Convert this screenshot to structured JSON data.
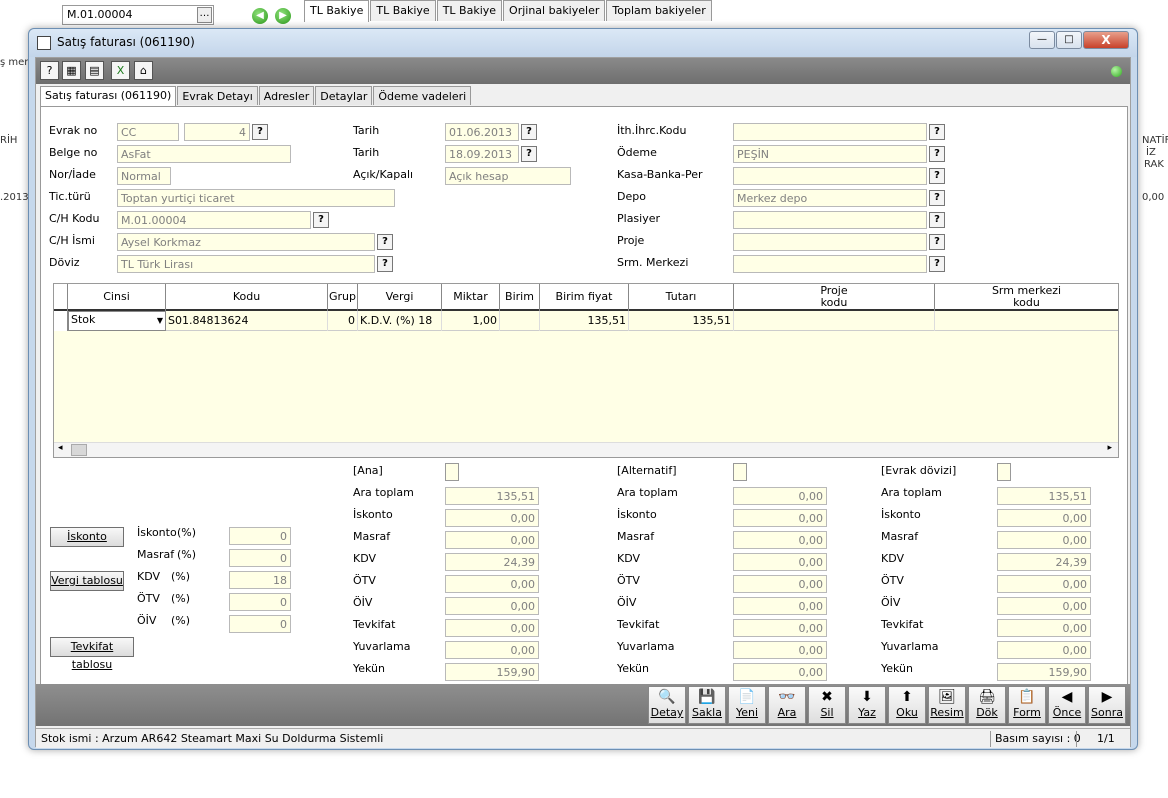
{
  "background": {
    "account_combo": "M.01.00004",
    "tabs": [
      "TL Bakiye",
      "TL Bakiye",
      "TL Bakiye",
      "Orjinal bakiyeler",
      "Toplam bakiyeler"
    ],
    "left_fragments": [
      "ş merk",
      "RİH",
      ".2013"
    ],
    "right_fragments": [
      "NATİF",
      "İZ",
      "RAK",
      "0,00"
    ]
  },
  "window": {
    "title": "Satış faturası (061190)",
    "min_label": "—",
    "max_label": "□",
    "close_label": "X",
    "toolbar_icons": [
      "help-icon",
      "calculator-icon",
      "print-preview-icon",
      "excel-icon",
      "home-icon"
    ],
    "toolbar_glyphs": [
      "?",
      "▦",
      "▤",
      "X",
      "⌂"
    ]
  },
  "form_tabs": [
    "Satış faturası (061190)",
    "Evrak Detayı",
    "Adresler",
    "Detaylar",
    "Ödeme vadeleri"
  ],
  "fields": {
    "evrak_no": {
      "label": "Evrak no",
      "seri": "CC",
      "sira": "4"
    },
    "belge_no": {
      "label": "Belge no",
      "value": "AsFat"
    },
    "nor_iade": {
      "label": "Nor/İade",
      "value": "Normal"
    },
    "tic_turu": {
      "label": "Tic.türü",
      "value": "Toptan yurtiçi ticaret"
    },
    "ch_kodu": {
      "label": "C/H Kodu",
      "value": "M.01.00004"
    },
    "ch_ismi": {
      "label": "C/H İsmi",
      "value": "Aysel Korkmaz"
    },
    "doviz": {
      "label": "Döviz",
      "value": "TL  Türk Lirası"
    },
    "tarih1": {
      "label": "Tarih",
      "value": "01.06.2013"
    },
    "tarih2": {
      "label": "Tarih",
      "value": "18.09.2013"
    },
    "acik_kapali": {
      "label": "Açık/Kapalı",
      "value": "Açık hesap"
    },
    "ith_ihrc": {
      "label": "İth.İhrc.Kodu",
      "value": ""
    },
    "odeme": {
      "label": "Ödeme",
      "value": "PEŞİN"
    },
    "kasa_banka": {
      "label": "Kasa-Banka-Per",
      "value": ""
    },
    "depo": {
      "label": "Depo",
      "value": "Merkez depo"
    },
    "plasiyer": {
      "label": "Plasiyer",
      "value": ""
    },
    "proje": {
      "label": "Proje",
      "value": ""
    },
    "srm_merkezi": {
      "label": "Srm. Merkezi",
      "value": ""
    },
    "q": "?"
  },
  "grid": {
    "headers": {
      "cinsi": "Cinsi",
      "kodu": "Kodu",
      "grup": "Grup",
      "vergi": "Vergi",
      "miktar": "Miktar",
      "birim": "Birim",
      "birim_fiyat": "Birim fiyat",
      "tutari": "Tutarı",
      "proje1": "Proje",
      "proje2": "kodu",
      "srm1": "Srm merkezi",
      "srm2": "kodu"
    },
    "row": {
      "cinsi": "Stok",
      "kodu": "S01.84813624",
      "grup": "0",
      "vergi": "K.D.V. (%) 18",
      "miktar": "1,00",
      "birim": "",
      "birim_fiyat": "135,51",
      "tutari": "135,51",
      "proje": "",
      "srm": ""
    }
  },
  "left_controls": {
    "iskonto_btn": "İskonto",
    "vergi_btn": "Vergi tablosu",
    "tevkifat_btn": "Tevkifat tablosu",
    "rows": [
      {
        "label": "İskonto",
        "unit": "(%)",
        "value": "0"
      },
      {
        "label": "Masraf",
        "unit": "(%)",
        "value": "0"
      },
      {
        "label": "KDV",
        "unit": "(%)",
        "value": "18"
      },
      {
        "label": "ÖTV",
        "unit": "(%)",
        "value": "0"
      },
      {
        "label": "ÖİV",
        "unit": "(%)",
        "value": "0"
      }
    ]
  },
  "totals": {
    "row_labels": [
      "Ara toplam",
      "İskonto",
      "Masraf",
      "KDV",
      "ÖTV",
      "ÖİV",
      "Tevkifat",
      "Yuvarlama",
      "Yekün"
    ],
    "ana": {
      "title": "[Ana]",
      "values": [
        "135,51",
        "0,00",
        "0,00",
        "24,39",
        "0,00",
        "0,00",
        "0,00",
        "0,00",
        "159,90"
      ]
    },
    "alternatif": {
      "title": "[Alternatif]",
      "values": [
        "0,00",
        "0,00",
        "0,00",
        "0,00",
        "0,00",
        "0,00",
        "0,00",
        "0,00",
        "0,00"
      ]
    },
    "evrak": {
      "title": "[Evrak dövizi]",
      "values": [
        "135,51",
        "0,00",
        "0,00",
        "24,39",
        "0,00",
        "0,00",
        "0,00",
        "0,00",
        "159,90"
      ]
    }
  },
  "actions": [
    {
      "label": "Detay",
      "glyph": "🔍"
    },
    {
      "label": "Sakla",
      "glyph": "💾"
    },
    {
      "label": "Yeni",
      "glyph": "📄"
    },
    {
      "label": "Ara",
      "glyph": "👓"
    },
    {
      "label": "Sil",
      "glyph": "✖"
    },
    {
      "label": "Yaz",
      "glyph": "⬇"
    },
    {
      "label": "Oku",
      "glyph": "⬆"
    },
    {
      "label": "Resim",
      "glyph": "🖼"
    },
    {
      "label": "Dök",
      "glyph": "🖨"
    },
    {
      "label": "Form",
      "glyph": "📋"
    },
    {
      "label": "Önce",
      "glyph": "◀"
    },
    {
      "label": "Sonra",
      "glyph": "▶"
    }
  ],
  "status": {
    "stok_ismi": "Stok ismi : Arzum AR642 Steamart Maxi Su Doldurma Sistemli",
    "basim": "Basım sayısı : 0",
    "page": "1/1"
  }
}
